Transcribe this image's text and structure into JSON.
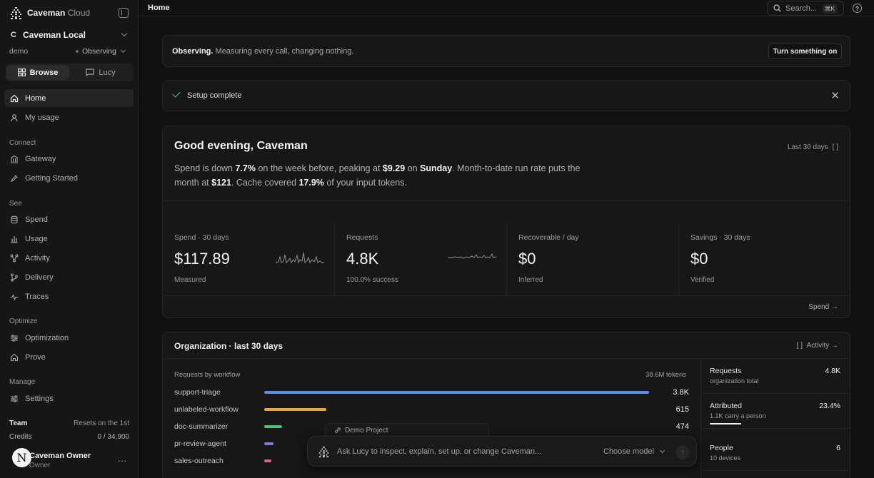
{
  "sidebar": {
    "brand_primary": "Caveman",
    "brand_secondary": "Cloud",
    "workspace_letter": "C",
    "workspace_name": "Caveman Local",
    "env_name": "demo",
    "env_mode": "Observing",
    "seg_browse": "Browse",
    "seg_lucy": "Lucy",
    "nav_home": "Home",
    "nav_my_usage": "My usage",
    "section_connect": "Connect",
    "nav_gateway": "Gateway",
    "nav_getting_started": "Getting Started",
    "section_see": "See",
    "nav_spend": "Spend",
    "nav_usage": "Usage",
    "nav_activity": "Activity",
    "nav_delivery": "Delivery",
    "nav_traces": "Traces",
    "section_optimize": "Optimize",
    "nav_optimization": "Optimization",
    "nav_prove": "Prove",
    "section_manage": "Manage",
    "nav_settings": "Settings",
    "team_label": "Team",
    "team_reset": "Resets on the 1st",
    "credits_label": "Credits",
    "credits_value": "0 / 34,900",
    "user_initial": "N",
    "user_name": "Caveman Owner",
    "user_role": "Owner",
    "user_more": "..."
  },
  "topbar": {
    "breadcrumb": "Home",
    "search_placeholder": "Search...",
    "search_shortcut": "⌘K",
    "help_glyph": "?"
  },
  "observing": {
    "bold": "Observing.",
    "text": " Measuring every call, changing nothing.",
    "button": "Turn something on"
  },
  "setup": {
    "text": "Setup complete",
    "close": "✕"
  },
  "home": {
    "greeting": "Good evening, Caveman",
    "range": "Last 30 days",
    "range_icon": "[ ]",
    "summary": {
      "p1": "Spend is down ",
      "v1": "7.7%",
      "p2": " on the week before, peaking at ",
      "v2": "$9.29",
      "p3": " on ",
      "v3": "Sunday",
      "p4": ". Month-to-date run rate puts the month at ",
      "v4": "$121",
      "p5": ". Cache covered ",
      "v5": "17.9%",
      "p6": " of your input tokens."
    },
    "kpis": [
      {
        "label": "Spend · 30 days",
        "value": "$117.89",
        "sub": "Measured"
      },
      {
        "label": "Requests",
        "value": "4.8K",
        "sub": "100.0% success"
      },
      {
        "label": "Recoverable / day",
        "value": "$0",
        "sub": "Inferred"
      },
      {
        "label": "Savings · 30 days",
        "value": "$0",
        "sub": "Verified"
      }
    ],
    "spend_link": "Spend →"
  },
  "org": {
    "title": "Organization · last 30 days",
    "activity_link": "Activity →",
    "activity_icon": "[ ]",
    "left_heading": "Requests by workflow",
    "left_total": "38.6M tokens",
    "workflows": [
      {
        "name": "support-triage",
        "value": "3.8K",
        "share": 1.0,
        "color": "#5b8fe0"
      },
      {
        "name": "unlabeled-workflow",
        "value": "615",
        "share": 0.161,
        "color": "#e3a93a"
      },
      {
        "name": "doc-summarizer",
        "value": "474",
        "share": 0.046,
        "color": "#4fbf7a"
      },
      {
        "name": "pr-review-agent",
        "value": "",
        "share": 0.025,
        "color": "#8d74e6"
      },
      {
        "name": "sales-outreach",
        "value": "",
        "share": 0.018,
        "color": "#e0617b"
      }
    ],
    "stats": [
      {
        "name": "Requests",
        "sub": "organization total",
        "value": "4.8K"
      },
      {
        "name": "Attributed",
        "sub": "1.1K carry a person",
        "value": "23.4%",
        "bar": 0.234
      },
      {
        "name": "People",
        "sub": "10 devices",
        "value": "6"
      }
    ]
  },
  "chat": {
    "project": "Demo Project",
    "placeholder": "Ask Lucy to inspect, explain, set up, or change Caveman...",
    "model": "Choose model",
    "send": "↑"
  },
  "colors": {
    "accent_green": "#4cc38a",
    "bg": "#111111"
  }
}
